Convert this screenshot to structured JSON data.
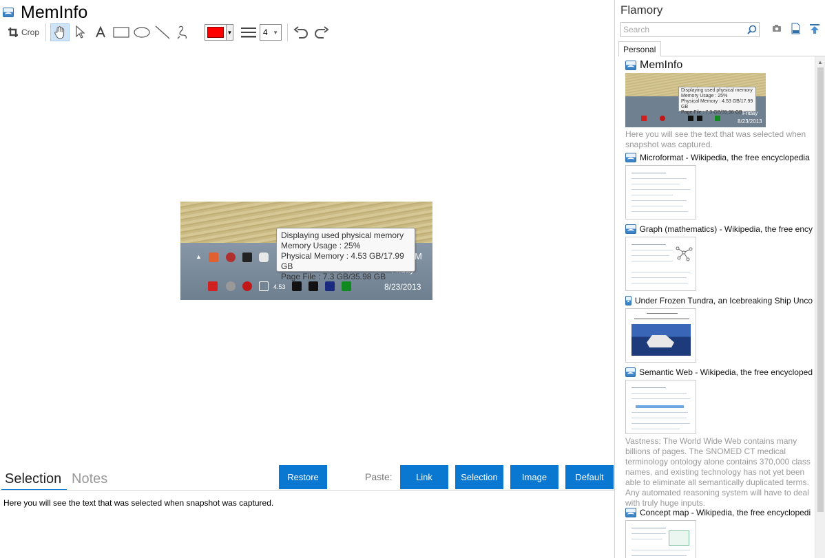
{
  "app": {
    "title": "MemInfo"
  },
  "toolbar": {
    "crop_label": "Crop",
    "tools": [
      "hand-tool",
      "pointer-tool",
      "text-tool",
      "rectangle-tool",
      "ellipse-tool",
      "line-tool",
      "freehand-tool"
    ],
    "color": "#ff0000",
    "line_width": "4",
    "undo": "undo-icon",
    "redo": "redo-icon"
  },
  "canvas": {
    "tooltip": {
      "line1": "Displaying used physical memory",
      "line2": "Memory Usage : 25%",
      "line3": "Physical Memory : 4.53 GB/17.99 GB",
      "line4": "Page File : 7.3 GB/35.98 GB"
    },
    "clock_time": "M",
    "clock_day": "Friday",
    "clock_date": "8/23/2013",
    "tray_value": "4.53"
  },
  "bottom": {
    "tabs": [
      {
        "label": "Selection",
        "active": true
      },
      {
        "label": "Notes",
        "active": false
      }
    ],
    "restore_label": "Restore",
    "paste_label": "Paste:",
    "paste_buttons": [
      "Link",
      "Selection",
      "Image",
      "Default"
    ],
    "selection_text": "Here you will see the text that was selected when snapshot was captured."
  },
  "side": {
    "title": "Flamory",
    "search_placeholder": "Search",
    "tab": "Personal",
    "items": [
      {
        "title": "MemInfo",
        "thumb": {
          "line1": "Displaying used physical memory",
          "line2": "Memory Usage : 25%",
          "line3": "Physical Memory : 4.53 GB/17.99 GB",
          "line4": "Page File : 7.3 GB/35.98 GB",
          "day": "Friday",
          "date": "8/23/2013"
        },
        "desc": "Here you will see the text that was selected when snapshot was captured."
      },
      {
        "title": "Microformat - Wikipedia, the free encyclopedia"
      },
      {
        "title": "Graph (mathematics) - Wikipedia, the free ency"
      },
      {
        "title": "Under Frozen Tundra, an Icebreaking Ship Unco"
      },
      {
        "title": "Semantic Web - Wikipedia, the free encycloped",
        "desc": "Vastness: The World Wide Web contains many billions of pages. The SNOMED CT medical terminology ontology alone contains 370,000 class names, and existing technology has not yet been able to eliminate all semantically duplicated terms. Any automated reasoning system will have to deal with truly huge inputs."
      },
      {
        "title": "Concept map - Wikipedia, the free encyclopedi"
      }
    ]
  },
  "colors": {
    "accent": "#0a78d0",
    "active_tool": "#cfe3f7"
  }
}
